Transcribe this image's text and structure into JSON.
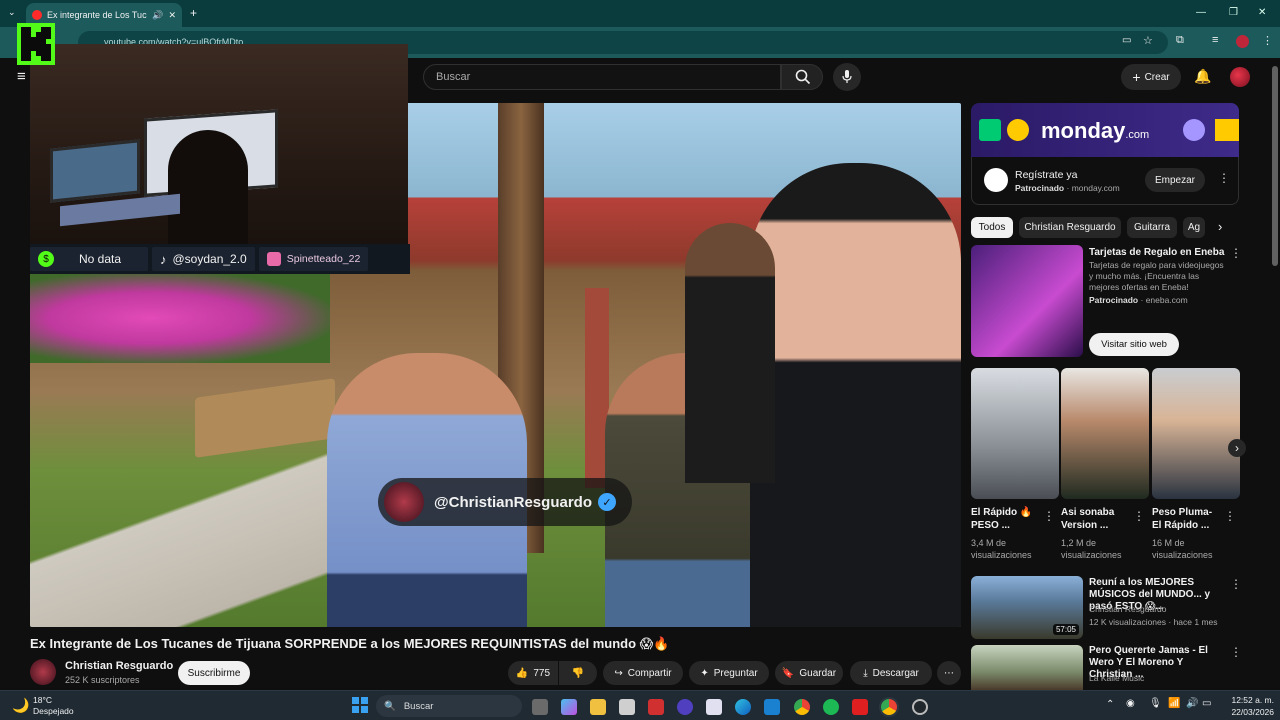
{
  "browser": {
    "tab_title": "Ex integrante de Los Tucanes",
    "url": "youtube.com/watch?v=ulBOfrMDto"
  },
  "youtube": {
    "search_placeholder": "Buscar",
    "create_label": "Crear"
  },
  "stream_overlay": {
    "items": [
      {
        "label": "No data"
      },
      {
        "label": "@soydan_2.0"
      },
      {
        "label": "Spinetteado_22"
      }
    ]
  },
  "video": {
    "watermark_handle": "@ChristianResguardo",
    "title": "Ex Integrante de Los Tucanes de Tijuana SORPRENDE a los MEJORES REQUINTISTAS del mundo 😱🔥",
    "channel_name": "Christian Resguardo",
    "subscribers": "252 K suscriptores",
    "subscribe_label": "Suscribirme",
    "likes": "775",
    "share_label": "Compartir",
    "ask_label": "Preguntar",
    "save_label": "Guardar",
    "download_label": "Descargar"
  },
  "sidebar": {
    "ad1": {
      "brand": "monday",
      "brand_suffix": ".com",
      "title": "Regístrate ya",
      "sponsor_label": "Patrocinado",
      "domain": "monday.com",
      "button": "Empezar"
    },
    "chips": [
      "Todos",
      "Christian Resguardo",
      "Guitarra",
      "Ag"
    ],
    "ad2": {
      "title": "Tarjetas de Regalo en Eneba",
      "description": "Tarjetas de regalo para videojuegos y mucho más. ¡Encuentra las mejores ofertas en Eneba!",
      "sponsor_label": "Patrocinado",
      "domain": "eneba.com",
      "button": "Visitar sitio web"
    },
    "shorts": [
      {
        "title": "El Rápido 🔥 PESO ...",
        "views": "3,4 M de visualizaciones"
      },
      {
        "title": "Asi sonaba Version ...",
        "views": "1,2 M de visualizaciones"
      },
      {
        "title": "Peso Pluma- El Rápido ...",
        "views": "16 M de visualizaciones"
      }
    ],
    "videos": [
      {
        "title": "Reuní a los MEJORES MÚSICOS del MUNDO... y pasó ESTO 😱...",
        "channel": "Christian Resguardo",
        "meta": "12 K visualizaciones · hace 1 mes",
        "duration": "57:05"
      },
      {
        "title": "Pero Quererte Jamas - El Wero Y El Moreno Y Christian ...",
        "channel": "La Kalle Music",
        "meta": "",
        "duration": ""
      }
    ]
  },
  "taskbar": {
    "weather_temp": "18°C",
    "weather_desc": "Despejado",
    "search_label": "Buscar",
    "time": "12:52 a. m.",
    "date": "22/03/2026"
  },
  "colors": {
    "yt_bg": "#0f0f0f",
    "chrome_teal": "#1c5a5c",
    "kick_green": "#53fc18",
    "verified_blue": "#3ea6ff"
  }
}
